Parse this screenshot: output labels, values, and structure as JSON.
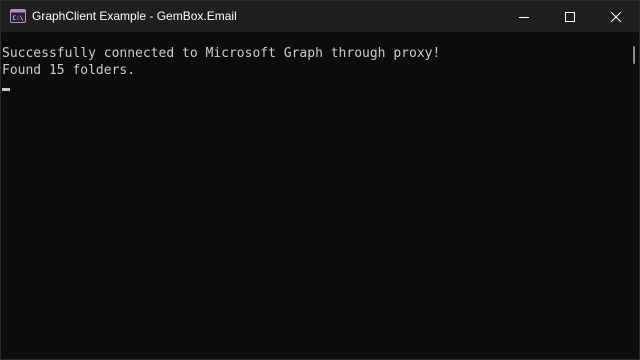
{
  "window": {
    "title": "GraphClient Example - GemBox.Email",
    "icon": "console-app-icon"
  },
  "controls": {
    "minimize": "minimize-icon",
    "maximize": "maximize-icon",
    "close": "close-icon"
  },
  "console": {
    "lines": [
      "Successfully connected to Microsoft Graph through proxy!",
      "Found 15 folders."
    ]
  },
  "colors": {
    "background": "#0c0c0c",
    "titlebar": "#1f1f1f",
    "text": "#cccccc",
    "icon_accent": "#8e44ad"
  }
}
